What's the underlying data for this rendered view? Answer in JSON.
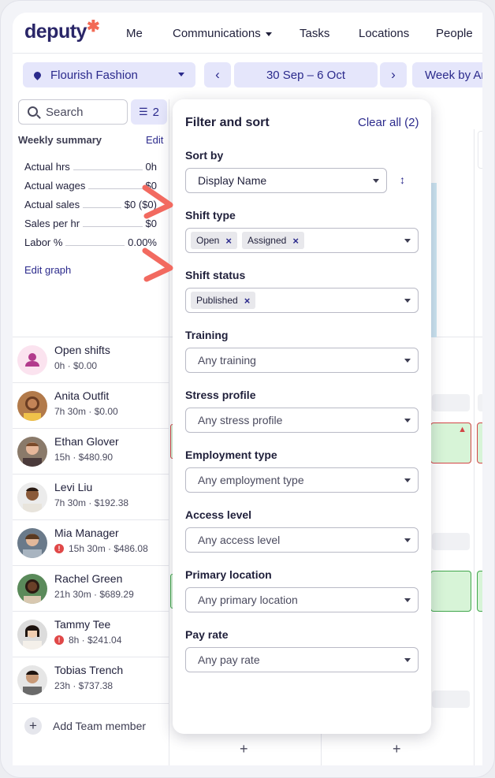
{
  "nav": {
    "logo": "deputy",
    "items": [
      "Me",
      "Communications",
      "Tasks",
      "Locations",
      "People"
    ]
  },
  "toolbar": {
    "location": "Flourish Fashion",
    "date_range": "30 Sep – 6 Oct",
    "view": "Week by Area",
    "prev": "‹",
    "next": "›"
  },
  "sidebar": {
    "search_placeholder": "Search",
    "filter_count": "2",
    "weekly_summary_title": "Weekly summary",
    "edit": "Edit",
    "stats": [
      {
        "label": "Actual hrs",
        "value": "0h"
      },
      {
        "label": "Actual wages",
        "value": "$0"
      },
      {
        "label": "Actual sales",
        "value": "$0 ($0)"
      },
      {
        "label": "Sales per hr",
        "value": "$0"
      },
      {
        "label": "Labor %",
        "value": "0.00%"
      }
    ],
    "edit_graph": "Edit graph",
    "roster": [
      {
        "name": "Open shifts",
        "sub": "0h · $0.00",
        "warn": false
      },
      {
        "name": "Anita Outfit",
        "sub": "7h 30m · $0.00",
        "warn": false
      },
      {
        "name": "Ethan Glover",
        "sub": "15h · $480.90",
        "warn": false
      },
      {
        "name": "Levi Liu",
        "sub": "7h 30m · $192.38",
        "warn": false
      },
      {
        "name": "Mia Manager",
        "sub": "15h 30m · $486.08",
        "warn": true
      },
      {
        "name": "Rachel Green",
        "sub": "21h 30m · $689.29",
        "warn": false
      },
      {
        "name": "Tammy Tee",
        "sub": "8h · $241.04",
        "warn": true
      },
      {
        "name": "Tobias Trench",
        "sub": "23h · $737.38",
        "warn": false
      }
    ],
    "add_member": "Add Team member"
  },
  "filter_panel": {
    "title": "Filter and sort",
    "clear_all": "Clear all (2)",
    "sort_by_label": "Sort by",
    "sort_by_value": "Display Name",
    "shift_type_label": "Shift type",
    "shift_type_tags": [
      "Open",
      "Assigned"
    ],
    "shift_status_label": "Shift status",
    "shift_status_tags": [
      "Published"
    ],
    "fields": [
      {
        "label": "Training",
        "value": "Any training"
      },
      {
        "label": "Stress profile",
        "value": "Any stress profile"
      },
      {
        "label": "Employment type",
        "value": "Any employment type"
      },
      {
        "label": "Access level",
        "value": "Any access level"
      },
      {
        "label": "Primary location",
        "value": "Any primary location"
      },
      {
        "label": "Pay rate",
        "value": "Any pay rate"
      }
    ]
  },
  "colors": {
    "brand": "#2a2668",
    "accent": "#2b2a8c",
    "logo_star": "#f26a55",
    "annotation_arrow": "#f26a60",
    "warning": "#e04848",
    "shift_green": "#d7f4d7"
  }
}
